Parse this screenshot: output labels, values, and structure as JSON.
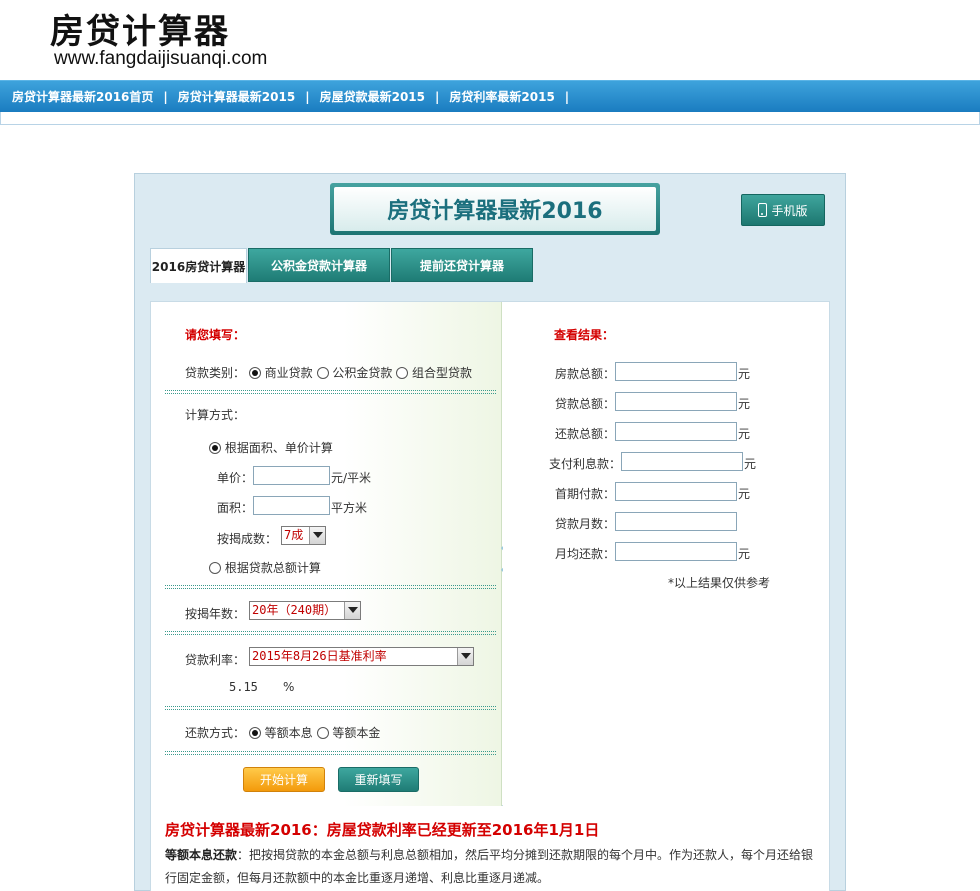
{
  "site": {
    "logo_title": "房贷计算器",
    "logo_url": "www.fangdaijisuanqi.com"
  },
  "nav": {
    "items": [
      "房贷计算器最新2016首页",
      "房贷计算器最新2015",
      "房屋贷款最新2015",
      "房贷利率最新2015"
    ],
    "separator": "|"
  },
  "panel": {
    "title": "房贷计算器最新2016",
    "mobile_label": "手机版",
    "tabs": [
      "2016房贷计算器",
      "公积金贷款计算器",
      "提前还贷计算器"
    ]
  },
  "form": {
    "heading": "请您填写：",
    "loan_type_label": "贷款类别：",
    "loan_types": [
      "商业贷款",
      "公积金贷款",
      "组合型贷款"
    ],
    "calc_method_label": "计算方式：",
    "method_area": "根据面积、单价计算",
    "unit_price_label": "单价：",
    "unit_price_unit": "元/平米",
    "area_label": "面积：",
    "area_unit": "平方米",
    "ratio_label": "按揭成数：",
    "ratio_value": "7成",
    "method_total": "根据贷款总额计算",
    "years_label": "按揭年数：",
    "years_value": "20年（240期）",
    "rate_label": "贷款利率：",
    "rate_value": "2015年8月26日基准利率",
    "rate_number": "5.15",
    "rate_unit": "%",
    "repay_label": "还款方式：",
    "repay_types": [
      "等额本息",
      "等额本金"
    ],
    "start_button": "开始计算",
    "reset_button": "重新填写"
  },
  "results": {
    "heading": "查看结果：",
    "rows": [
      {
        "label": "房款总额：",
        "unit": "元"
      },
      {
        "label": "贷款总额：",
        "unit": "元"
      },
      {
        "label": "还款总额：",
        "unit": "元"
      },
      {
        "label": "支付利息款：",
        "unit": "元"
      },
      {
        "label": "首期付款：",
        "unit": "元"
      },
      {
        "label": "贷款月数：",
        "unit": ""
      },
      {
        "label": "月均还款：",
        "unit": "元"
      }
    ],
    "disclaimer": "*以上结果仅供参考"
  },
  "note": {
    "title": "房贷计算器最新2016：房屋贷款利率已经更新至2016年1月1日",
    "bold_prefix": "等额本息还款",
    "text": "：把按揭贷款的本金总额与利息总额相加，然后平均分摊到还款期限的每个月中。作为还款人，每个月还给银行固定金额，但每月还款额中的本金比重逐月递增、利息比重逐月递减。"
  },
  "colors": {
    "nav_blue": "#1a7cc0",
    "teal": "#1f7c75",
    "red": "#d40000",
    "orange": "#f39a0b"
  }
}
